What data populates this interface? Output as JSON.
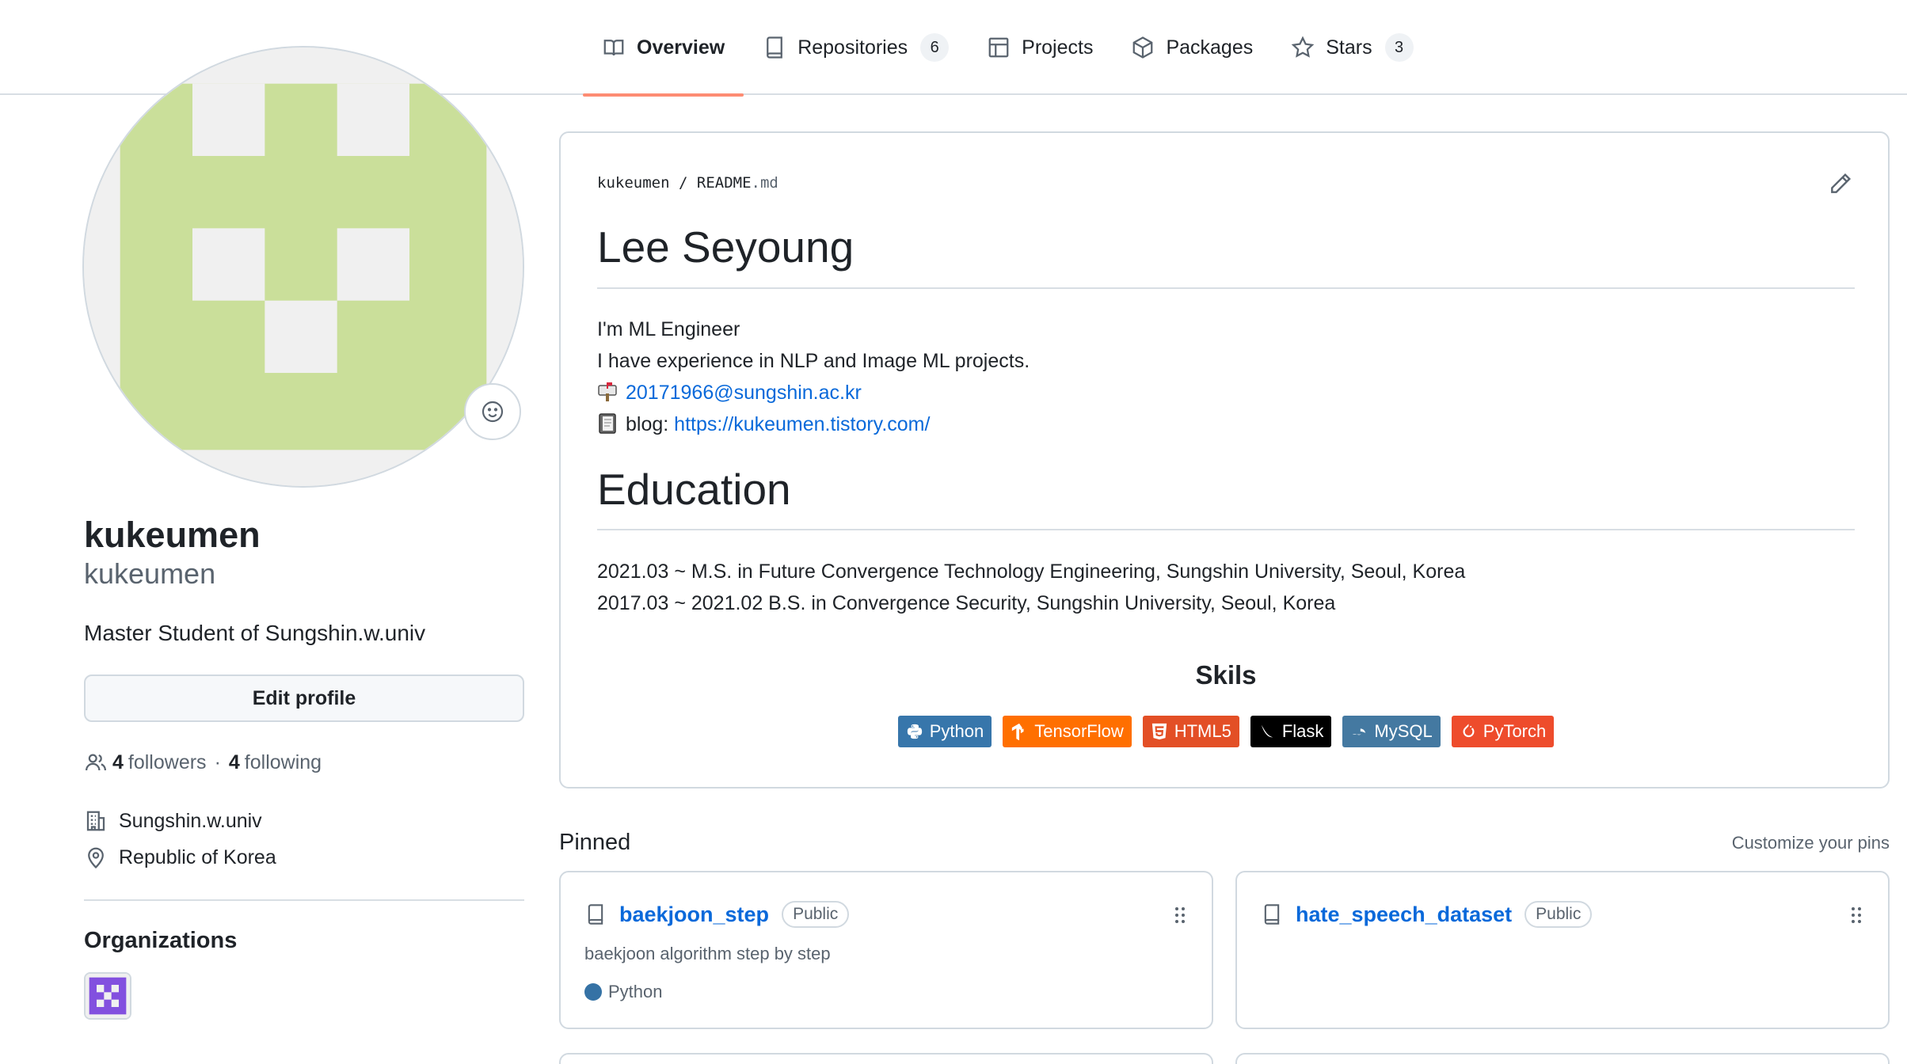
{
  "nav": {
    "tabs": [
      {
        "label": "Overview",
        "icon": "book-icon",
        "count": ""
      },
      {
        "label": "Repositories",
        "icon": "repo-icon",
        "count": "6"
      },
      {
        "label": "Projects",
        "icon": "table-icon",
        "count": ""
      },
      {
        "label": "Packages",
        "icon": "package-icon",
        "count": ""
      },
      {
        "label": "Stars",
        "icon": "star-icon",
        "count": "3"
      }
    ]
  },
  "profile": {
    "fullname": "kukeumen",
    "username": "kukeumen",
    "bio": "Master Student of Sungshin.w.univ",
    "edit_label": "Edit profile",
    "followers_count": "4",
    "followers_label": "followers",
    "separator": "·",
    "following_count": "4",
    "following_label": "following",
    "organization_name": "Sungshin.w.univ",
    "location": "Republic of Korea",
    "organizations_title": "Organizations",
    "avatar_color": "#cadf9a",
    "org_avatar_color": "#8250df"
  },
  "readme": {
    "owner": "kukeumen",
    "slash": "/",
    "file_base": "README",
    "file_ext": ".md",
    "title": "Lee Seyoung",
    "intro_line1": "I'm ML Engineer",
    "intro_line2": "I have experience in NLP and Image ML projects.",
    "email": "20171966@sungshin.ac.kr",
    "blog_label": "blog:",
    "blog_url": "https://kukeumen.tistory.com/",
    "education_title": "Education",
    "education_line1": "2021.03 ~ M.S. in Future Convergence Technology Engineering, Sungshin University, Seoul, Korea",
    "education_line2": "2017.03 ~ 2021.02 B.S. in Convergence Security, Sungshin University, Seoul, Korea",
    "skills_title": "Skils",
    "badges": [
      {
        "label": "Python",
        "color": "#3776ab"
      },
      {
        "label": "TensorFlow",
        "color": "#ff6f00"
      },
      {
        "label": "HTML5",
        "color": "#e34f26"
      },
      {
        "label": "Flask",
        "color": "#000000"
      },
      {
        "label": "MySQL",
        "color": "#4479a1"
      },
      {
        "label": "PyTorch",
        "color": "#ee4c2c"
      }
    ]
  },
  "pinned": {
    "title": "Pinned",
    "customize_label": "Customize your pins",
    "repos": [
      {
        "name": "baekjoon_step",
        "visibility": "Public",
        "description": "baekjoon algorithm step by step",
        "language": "Python",
        "language_color": "#3572a5"
      },
      {
        "name": "hate_speech_dataset",
        "visibility": "Public",
        "description": "",
        "language": "",
        "language_color": ""
      }
    ]
  }
}
